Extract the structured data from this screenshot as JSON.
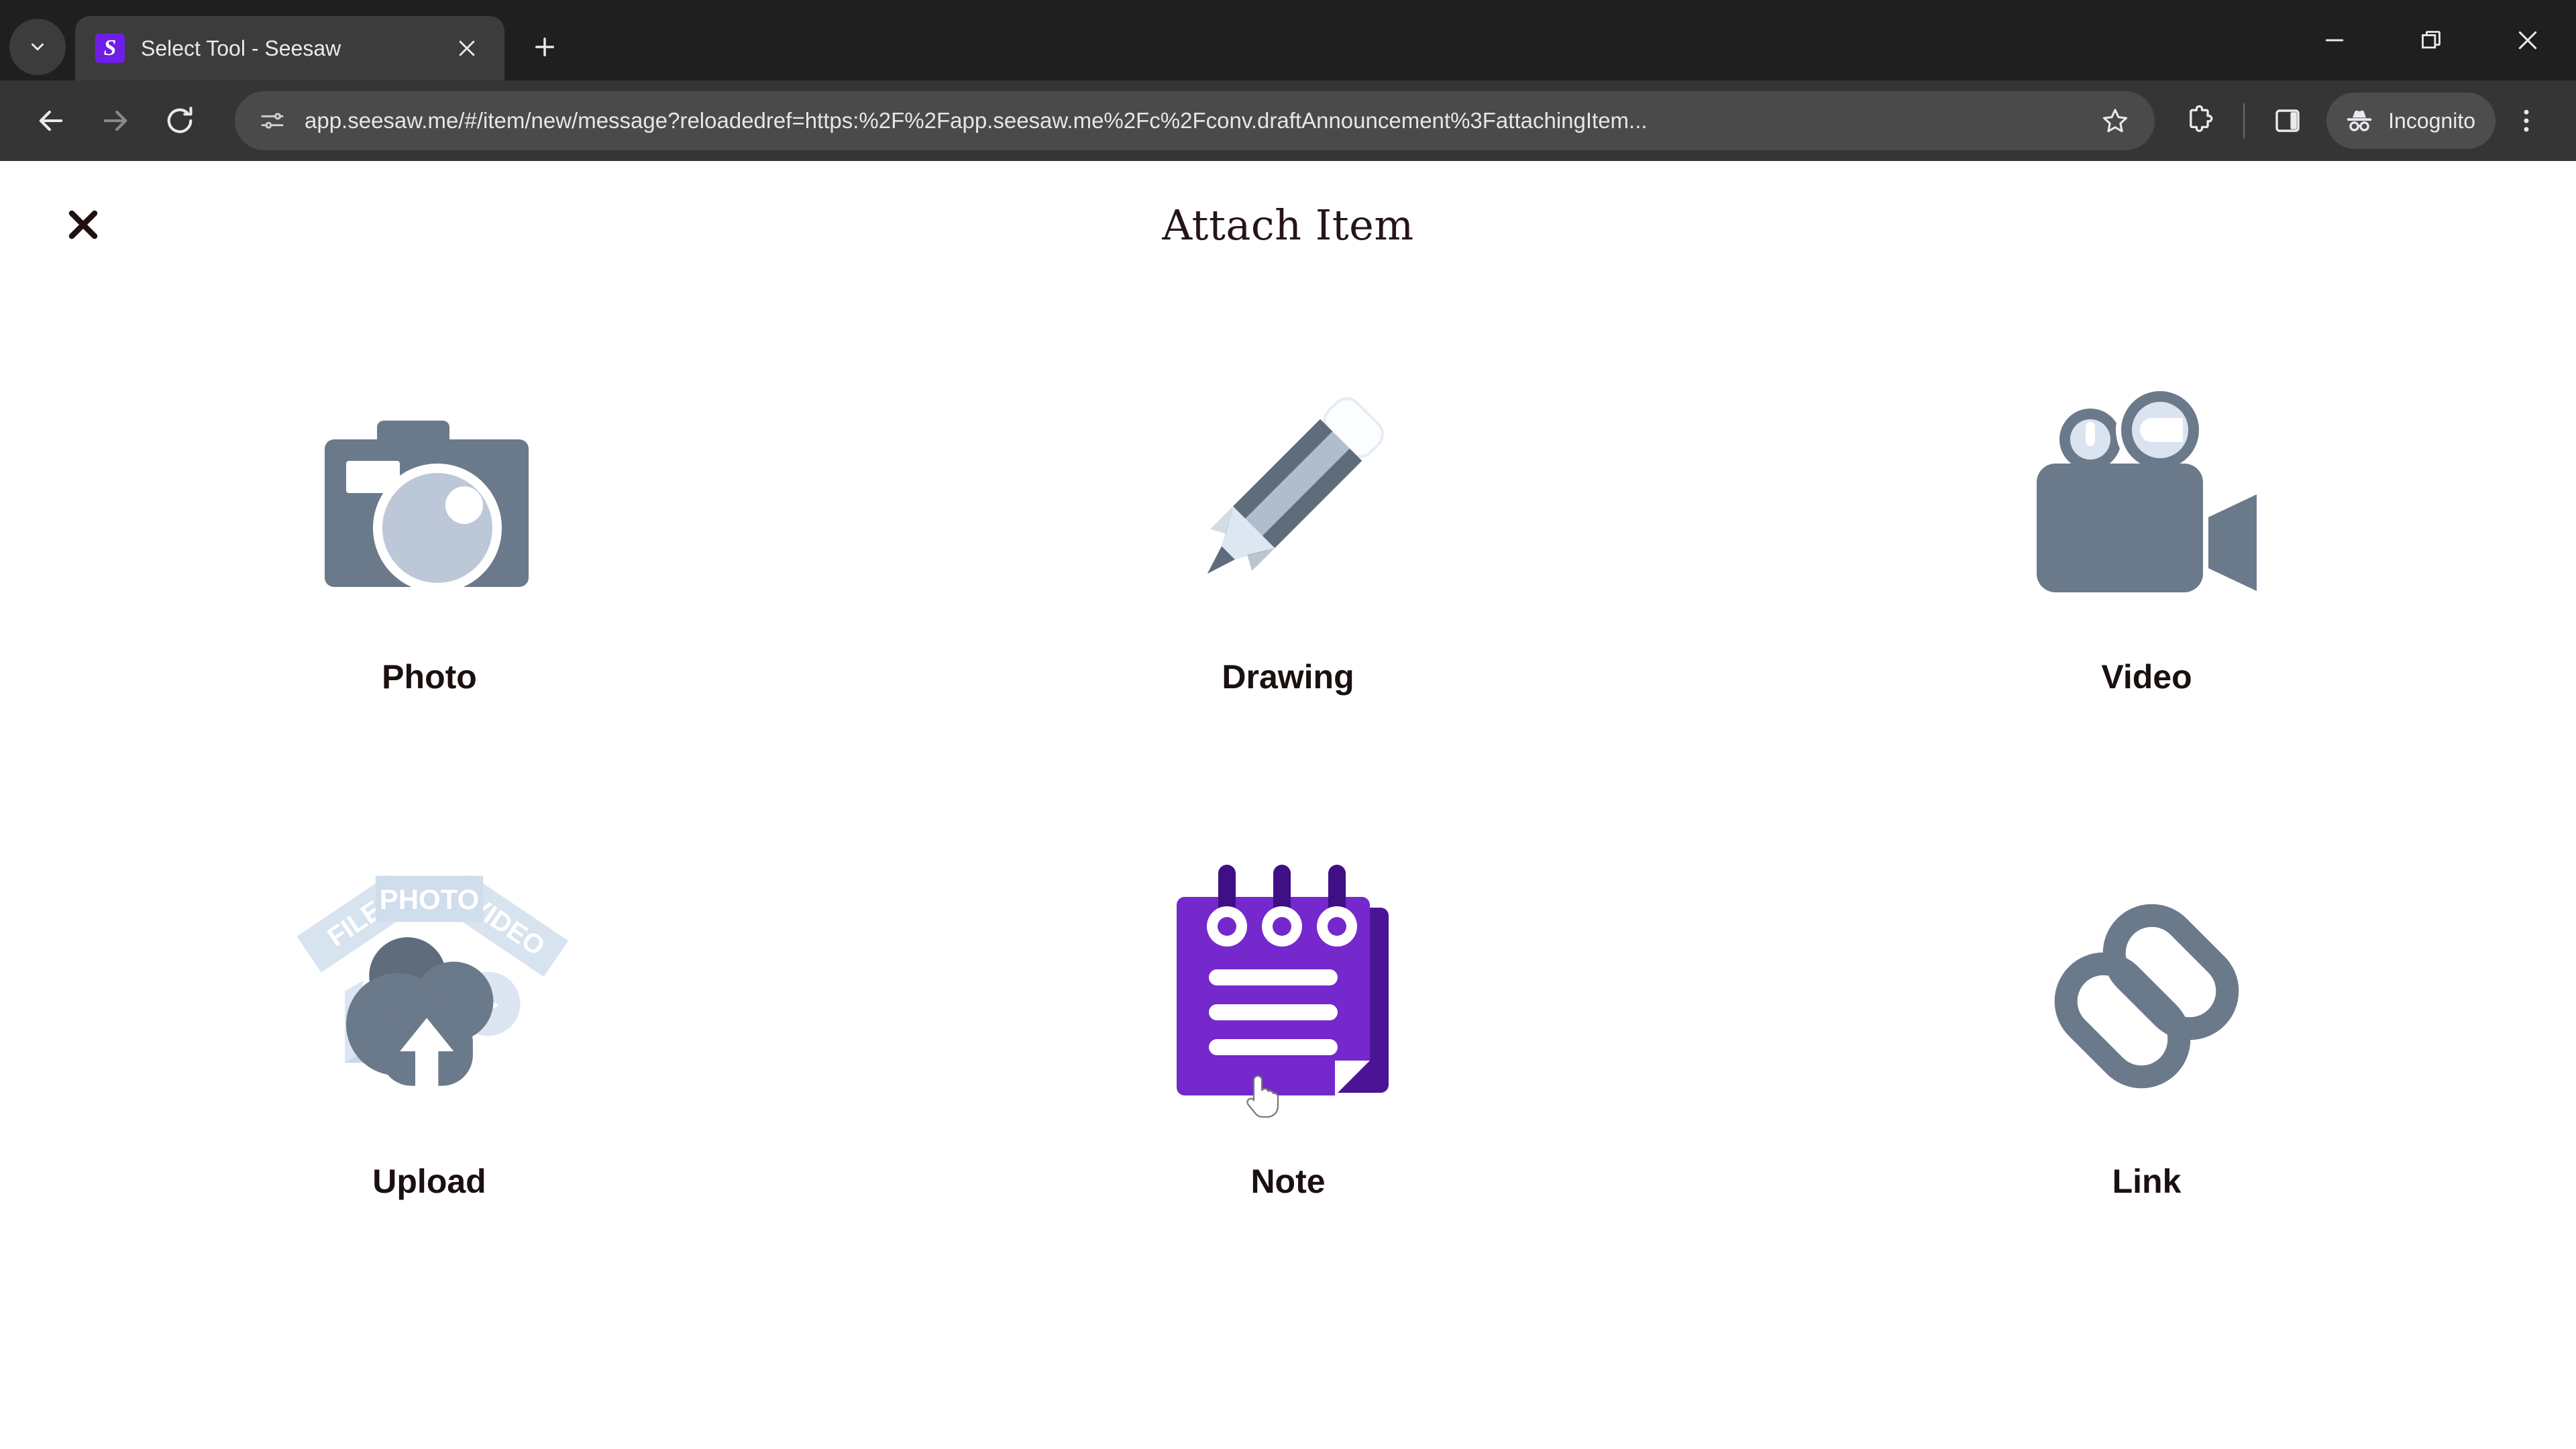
{
  "browser": {
    "tab_search_icon": "chevron-down-icon",
    "tab": {
      "favicon_letter": "S",
      "favicon_color": "#6E1EE6",
      "title": "Select Tool - Seesaw",
      "close_icon": "close-icon"
    },
    "new_tab_icon": "plus-icon",
    "window_controls": {
      "minimize": "minimize-icon",
      "restore": "restore-icon",
      "close": "close-icon"
    },
    "toolbar": {
      "back_icon": "back-arrow-icon",
      "forward_icon": "forward-arrow-icon",
      "reload_icon": "reload-icon",
      "site_info_icon": "tune-icon",
      "url": "app.seesaw.me/#/item/new/message?reloadedref=https:%2F%2Fapp.seesaw.me%2Fc%2Fconv.draftAnnouncement%3FattachingItem...",
      "bookmark_icon": "star-icon",
      "extensions_icon": "extensions-puzzle-icon",
      "side_panel_icon": "side-panel-icon",
      "incognito_label": "Incognito",
      "incognito_icon": "incognito-hat-icon",
      "menu_icon": "three-dot-menu-icon"
    }
  },
  "page": {
    "close_label": "close-dialog",
    "title": "Attach Item",
    "tools": [
      {
        "label": "Photo",
        "icon": "camera-icon"
      },
      {
        "label": "Drawing",
        "icon": "pencil-icon"
      },
      {
        "label": "Video",
        "icon": "video-camera-icon"
      },
      {
        "label": "Upload",
        "icon": "cloud-upload-icon"
      },
      {
        "label": "Note",
        "icon": "notepad-icon"
      },
      {
        "label": "Link",
        "icon": "chain-link-icon"
      }
    ],
    "upload_banners": [
      "FILE",
      "PHOTO",
      "VIDEO"
    ],
    "colors": {
      "icon_slate": "#6B7A8A",
      "icon_slate_dark": "#5E6C7C",
      "icon_light": "#C3CEDC",
      "icon_pale": "#DDE6EF",
      "note_purple": "#7528CC",
      "note_purple_dark": "#4B1496",
      "title_text": "#25151A",
      "label_text": "#1B1010"
    },
    "cursor": {
      "type": "pointer-hand-cursor",
      "over": "Note"
    }
  }
}
